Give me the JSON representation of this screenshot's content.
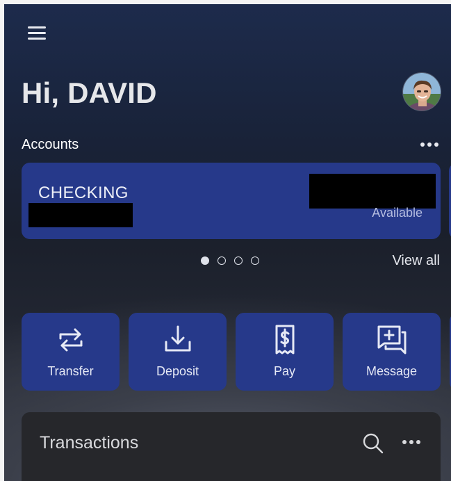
{
  "header": {
    "greeting": "Hi, DAVID"
  },
  "accounts": {
    "label": "Accounts",
    "cards": [
      {
        "name": "CHECKING",
        "available_label": "Available"
      }
    ],
    "pager_count": 4,
    "pager_active": 0,
    "view_all": "View all"
  },
  "actions": [
    {
      "label": "Transfer",
      "icon": "transfer-icon"
    },
    {
      "label": "Deposit",
      "icon": "deposit-icon"
    },
    {
      "label": "Pay",
      "icon": "pay-bill-icon"
    },
    {
      "label": "Message",
      "icon": "message-icon"
    }
  ],
  "transactions": {
    "title": "Transactions"
  },
  "colors": {
    "card": "#26398a",
    "panel": "#26272b",
    "text": "#ffffff"
  }
}
